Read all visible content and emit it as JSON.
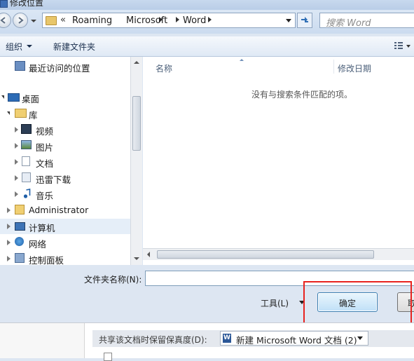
{
  "window": {
    "title": "修改位置"
  },
  "address": {
    "overflow": "«",
    "crumbs": [
      "Roaming",
      "Microsoft",
      "Word"
    ]
  },
  "search": {
    "placeholder": "搜索 Word"
  },
  "commands": {
    "organize": "组织",
    "new_folder": "新建文件夹"
  },
  "nav": {
    "recent": "最近访问的位置",
    "desktop": "桌面",
    "libraries": "库",
    "videos": "视频",
    "pictures": "图片",
    "documents": "文档",
    "thunder": "迅雷下载",
    "music": "音乐",
    "administrator": "Administrator",
    "computer": "计算机",
    "network": "网络",
    "control_panel": "控制面板"
  },
  "list": {
    "col_name": "名称",
    "col_modified": "修改日期",
    "empty_message": "没有与搜索条件匹配的项。"
  },
  "footer": {
    "folder_name_label": "文件夹名称(N):",
    "folder_name_value": "",
    "tools": "工具(L)",
    "ok": "确定",
    "cancel": "取消"
  },
  "underlying": {
    "fidelity_label": "共享该文档时保留保真度(D):",
    "fidelity_value": "新建 Microsoft Word 文档 (2)"
  },
  "colors": {
    "highlight_box": "#e8231f",
    "ok_button_border": "#3c7fb1",
    "window_bg": "#dde6f2"
  }
}
